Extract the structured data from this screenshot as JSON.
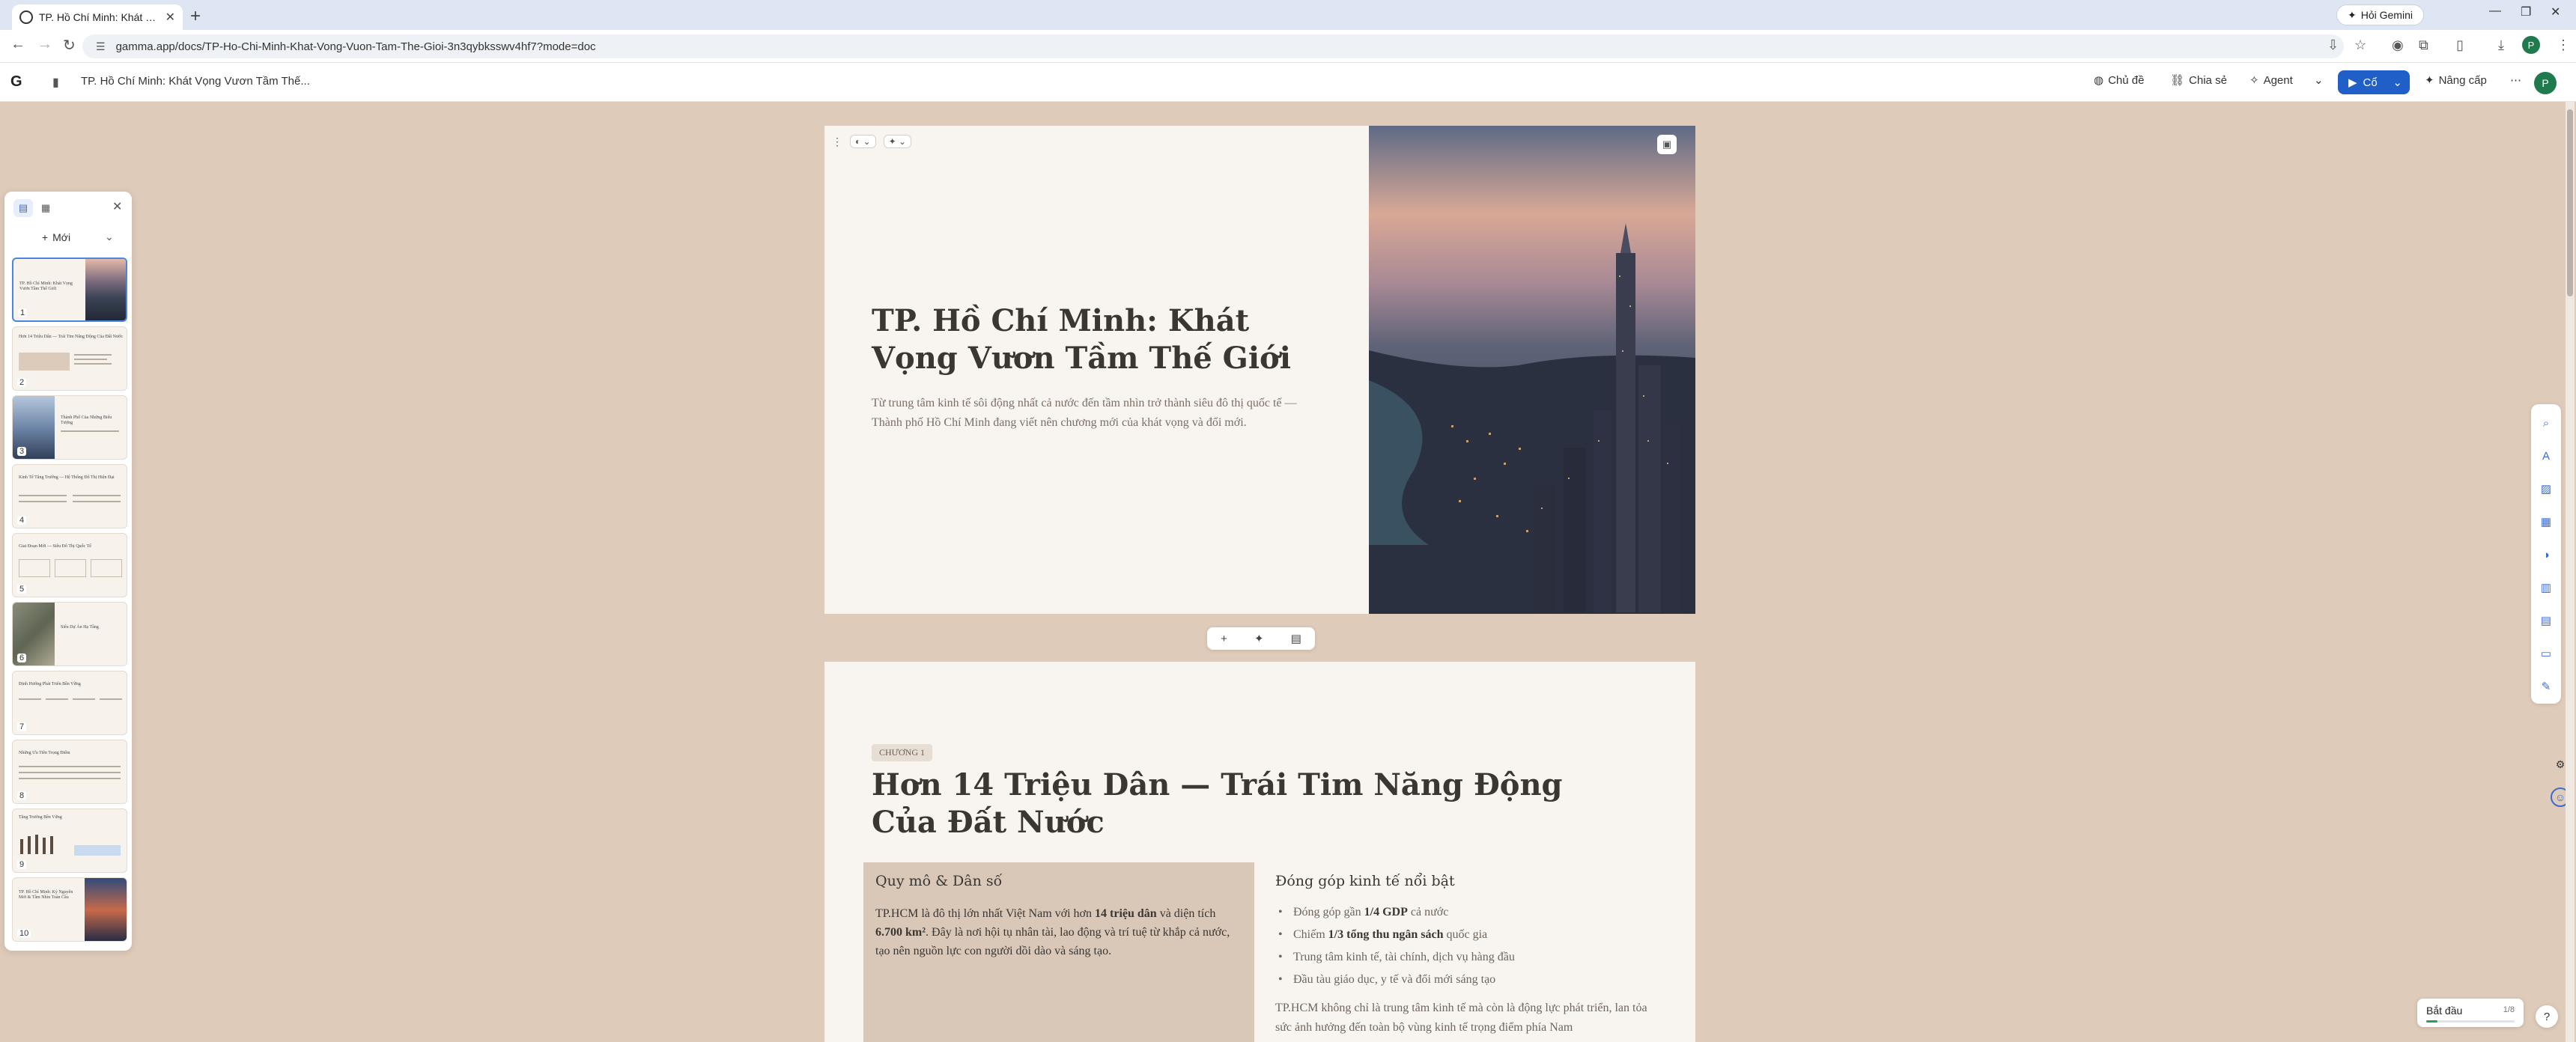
{
  "browser": {
    "tab_title": "TP. Hồ Chí Minh: Khát Vọng Vươn Tầm Thế Giới",
    "url": "gamma.app/docs/TP-Ho-Chi-Minh-Khat-Vong-Vuon-Tam-The-Gioi-3n3qybksswv4hf7?mode=doc",
    "gemini_label": "Hỏi Gemini",
    "profile_initial": "P"
  },
  "header": {
    "doc_title": "TP. Hồ Chí Minh: Khát Vọng Vươn Tầm Thế...",
    "theme_label": "Chủ đề",
    "share_label": "Chia sẻ",
    "agent_label": "Agent",
    "play_label": "Cổ",
    "upgrade_label": "Nâng cấp",
    "avatar_initial": "P"
  },
  "left_panel": {
    "new_label": "Mới",
    "slides": [
      {
        "num": "1",
        "title": "TP. Hồ Chí Minh: Khát Vọng Vươn Tầm Thế Giới"
      },
      {
        "num": "2",
        "title": "Hơn 14 Triệu Dân — Trái Tim Năng Động Của Đất Nước"
      },
      {
        "num": "3",
        "title": "Thành Phố Của Những Biểu Tượng"
      },
      {
        "num": "4",
        "title": "Kinh Tế Tăng Trưởng — Hệ Thống Đô Thị Hiện Đại"
      },
      {
        "num": "5",
        "title": "Giai Đoạn Mới — Siêu Đô Thị Quốc Tế"
      },
      {
        "num": "6",
        "title": "Siêu Dự Án Hạ Tầng"
      },
      {
        "num": "7",
        "title": "Định Hướng Phát Triển Bền Vững"
      },
      {
        "num": "8",
        "title": "Những Ưu Tiên Trọng Điểm"
      },
      {
        "num": "9",
        "title": "Tăng Trưởng Bền Vững"
      },
      {
        "num": "10",
        "title": "TP. Hồ Chí Minh: Kỷ Nguyên Mới & Tầm Nhìn Toàn Cầu"
      }
    ]
  },
  "card1": {
    "title": "TP. Hồ Chí Minh: Khát Vọng Vươn Tầm Thế Giới",
    "subtitle": "Từ trung tâm kinh tế sôi động nhất cả nước đến tầm nhìn trở thành siêu đô thị quốc tế — Thành phố Hồ Chí Minh đang viết nên chương mới của khát vọng và đổi mới."
  },
  "card2": {
    "chapter_tag": "CHƯƠNG 1",
    "title": "Hơn 14 Triệu Dân — Trái Tim Năng Động Của Đất Nước",
    "left_heading": "Quy mô & Dân số",
    "left_text_1": "TP.HCM là đô thị lớn nhất Việt Nam với hơn ",
    "left_bold_1": "14 triệu dân",
    "left_text_2": " và diện tích ",
    "left_bold_2": "6.700 km²",
    "left_text_3": ". Đây là nơi hội tụ nhân tài, lao động và trí tuệ từ khắp cả nước, tạo nên nguồn lực con người dồi dào và sáng tạo.",
    "right_heading": "Đóng góp kinh tế nổi bật",
    "bullets": [
      {
        "pre": "Đóng góp gần ",
        "bold": "1/4 GDP",
        "post": " cả nước"
      },
      {
        "pre": "Chiếm ",
        "bold": "1/3 tổng thu ngân sách",
        "post": " quốc gia"
      },
      {
        "pre": "Trung tâm kinh tế, tài chính, dịch vụ hàng đầu",
        "bold": "",
        "post": ""
      },
      {
        "pre": "Đầu tàu giáo dục, y tế và đổi mới sáng tạo",
        "bold": "",
        "post": ""
      }
    ],
    "right_para": "TP.HCM không chỉ là trung tâm kinh tế mà còn là động lực phát triển, lan tỏa sức ảnh hưởng đến toàn bộ vùng kinh tế trọng điểm phía Nam"
  },
  "start": {
    "label": "Bắt đầu",
    "count": "1/8",
    "progress": 0.125
  },
  "colors": {
    "canvas_bg": "#dfcbba",
    "card_bg": "#f8f5f0",
    "accent_blue": "#1f5fc7",
    "box_tan": "#d9c8b8"
  }
}
